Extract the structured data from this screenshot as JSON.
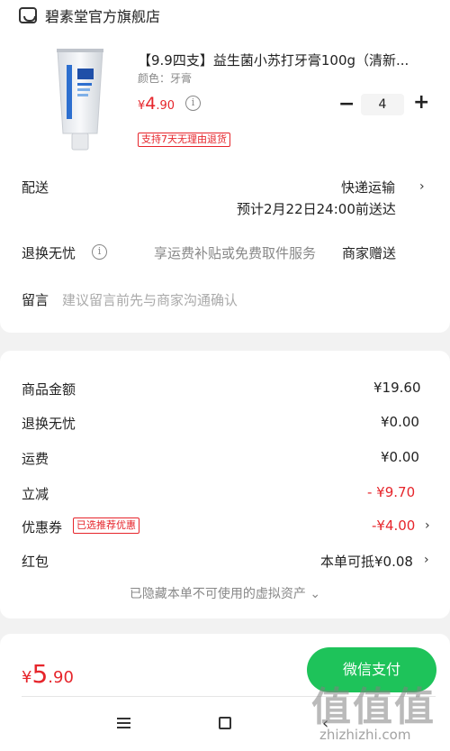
{
  "store": {
    "name": "碧素堂官方旗舰店",
    "icon": "store-icon"
  },
  "product": {
    "title": "【9.9四支】益生菌小苏打牙膏100g（清新...",
    "spec": "颜色：牙膏",
    "price_currency": "¥",
    "price_int": "4",
    "price_dec": ".90",
    "quantity": "4",
    "minus_label": "−",
    "plus_label": "+",
    "return_tag": "支持7天无理由退货"
  },
  "delivery": {
    "label": "配送",
    "method": "快递运输",
    "eta": "预计2月22日24:00前送达"
  },
  "worry_free": {
    "label": "退换无忧",
    "desc": "享运费补贴或免费取件服务",
    "value": "商家赠送"
  },
  "message": {
    "label": "留言",
    "placeholder": "建议留言前先与商家沟通确认"
  },
  "summary": {
    "rows": [
      {
        "label": "商品金额",
        "value": "¥19.60"
      },
      {
        "label": "退换无忧",
        "value": "¥0.00"
      },
      {
        "label": "运费",
        "value": "¥0.00"
      },
      {
        "label": "立减",
        "value": "- ¥9.70"
      },
      {
        "label": "优惠券",
        "tag": "已选推荐优惠",
        "value": "-¥4.00"
      },
      {
        "label": "红包",
        "value": "本单可抵¥0.08"
      }
    ],
    "hidden_assets": "已隐藏本单不可使用的虚拟资产 ⌄"
  },
  "pay": {
    "currency": "¥",
    "total_int": "5",
    "total_dec": ".90",
    "button_label": "微信支付",
    "accent_color": "#1ec35a",
    "price_color": "#e6252b"
  },
  "nav": {
    "menu_icon": "menu-icon",
    "home_icon": "home-icon",
    "back_icon": "back-icon"
  },
  "watermark": {
    "big": "值值值",
    "small": "zhizhizhi.com"
  }
}
